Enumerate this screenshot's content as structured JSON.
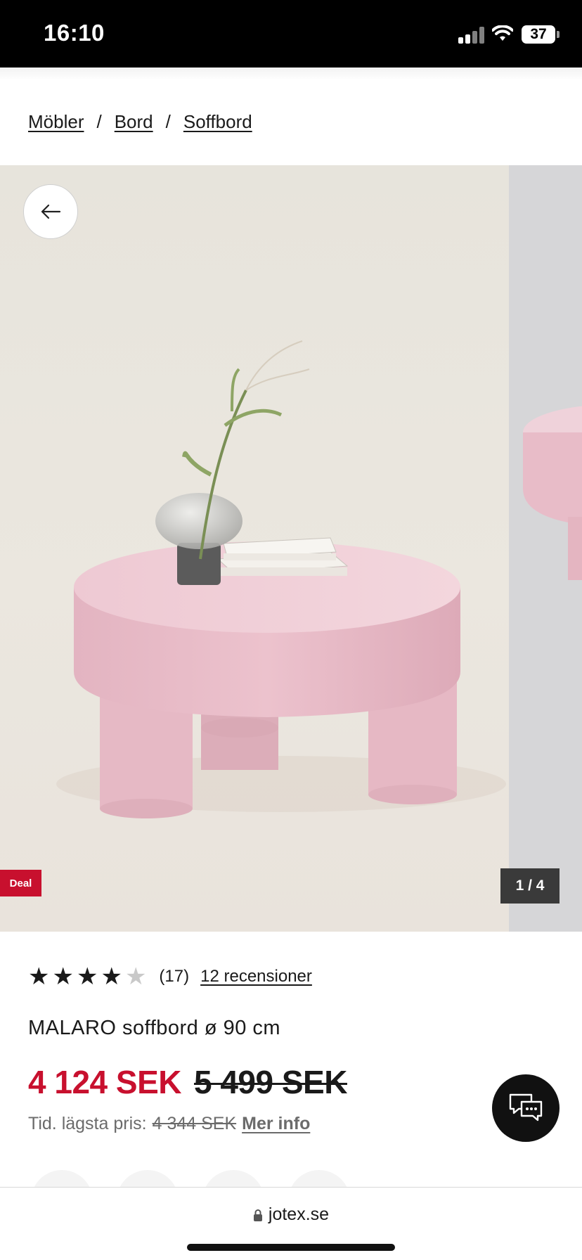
{
  "status_bar": {
    "time": "16:10",
    "battery": "37"
  },
  "breadcrumb": {
    "items": [
      "Möbler",
      "Bord",
      "Soffbord"
    ],
    "separator": "/"
  },
  "gallery": {
    "badge": "Deal",
    "counter": "1 / 4",
    "photo_description_icon": "product-photo-pink-round-table"
  },
  "product": {
    "rating": {
      "stars_filled": 4,
      "stars_total": 5,
      "count": "(17)",
      "reviews_link": "12 recensioner"
    },
    "title": "MALARO soffbord ø 90 cm",
    "price_now": "4 124 SEK",
    "price_old": "5 499 SEK",
    "lowest_price_label": "Tid. lägsta pris:",
    "lowest_price_value": "4 344 SEK",
    "more_info": "Mer info"
  },
  "browser": {
    "url": "jotex.se"
  },
  "colors": {
    "accent_red": "#c8102e",
    "table_pink": "#ebc3cf",
    "background": "#ffffff"
  }
}
